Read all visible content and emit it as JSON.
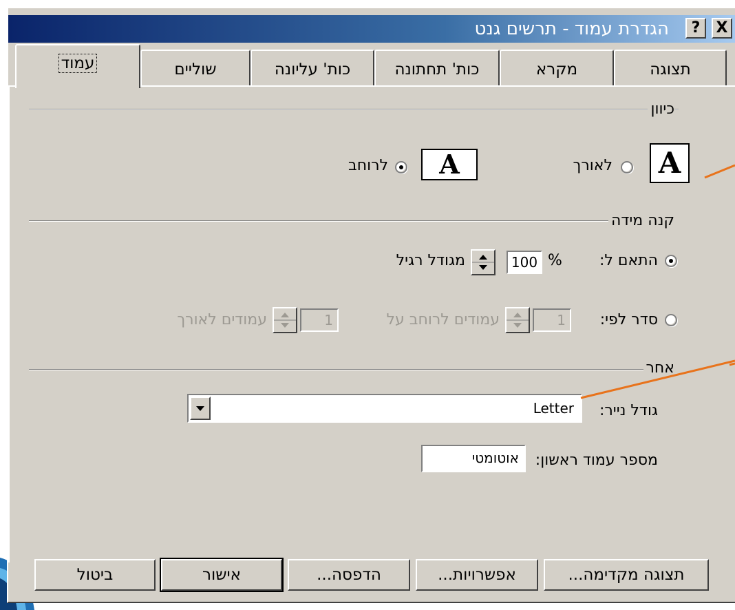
{
  "window": {
    "title": "הגדרת עמוד - תרשים גנט",
    "help_label": "?",
    "close_label": "X"
  },
  "tabs": [
    {
      "label": "עמוד",
      "active": true
    },
    {
      "label": "שוליים",
      "active": false
    },
    {
      "label": "כות' עליונה",
      "active": false
    },
    {
      "label": "כות' תחתונה",
      "active": false
    },
    {
      "label": "מקרא",
      "active": false
    },
    {
      "label": "תצוגה",
      "active": false
    }
  ],
  "orientation": {
    "legend": "כיוון",
    "portrait_label": "לאורך",
    "landscape_label": "לרוחב",
    "selected": "landscape",
    "icon_letter": "A"
  },
  "scaling": {
    "legend": "קנה מידה",
    "adjust_label": "התאם ל:",
    "percent_value": "100",
    "percent_symbol": "%",
    "normal_size_label": "מגודל רגיל",
    "fit_label": "סדר לפי:",
    "wide_value": "1",
    "wide_label": "עמודים לרוחב על",
    "tall_value": "1",
    "tall_label": "עמודים לאורך",
    "selected": "adjust"
  },
  "other": {
    "legend": "אחר",
    "paper_size_label": "גודל נייר:",
    "paper_size_value": "Letter",
    "first_page_label": "מספר עמוד ראשון:",
    "first_page_value": "אוטומטי"
  },
  "buttons": {
    "print_preview": "תצוגה מקדימה...",
    "options": "אפשרויות...",
    "print": "הדפסה...",
    "ok": "אישור",
    "cancel": "ביטול"
  },
  "colors": {
    "dialog_face": "#d4d0c8",
    "titlebar_start": "#0a246a",
    "titlebar_end": "#a6caf0",
    "callout_line": "#e8731c"
  }
}
